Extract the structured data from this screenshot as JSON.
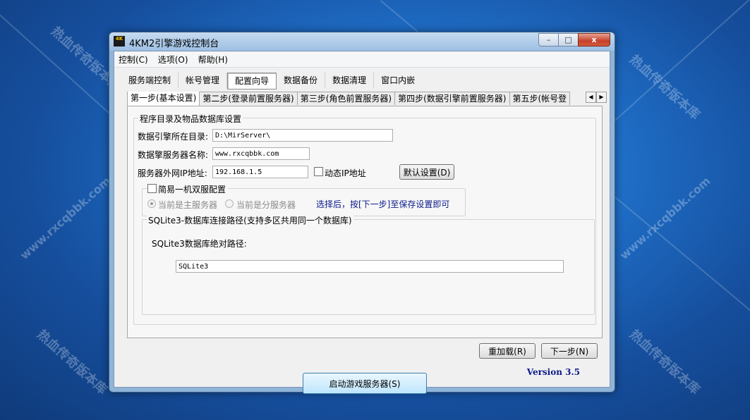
{
  "watermark": {
    "text_cn": "热血传奇版本库",
    "text_url": "www.rxcqbbk.com"
  },
  "window": {
    "title": "4KM2引擎游戏控制台",
    "icon_label": "4K",
    "minimize": "–",
    "maximize": "□",
    "close": "x"
  },
  "menu": [
    "控制(C)",
    "选项(O)",
    "帮助(H)"
  ],
  "top_tabs": [
    {
      "label": "服务端控制"
    },
    {
      "label": "帐号管理"
    },
    {
      "label": "配置向导",
      "active": true
    },
    {
      "label": "数据备份"
    },
    {
      "label": "数据清理"
    },
    {
      "label": "窗口内嵌"
    }
  ],
  "step_tabs": [
    {
      "label": "第一步(基本设置)",
      "active": true
    },
    {
      "label": "第二步(登录前置服务器)"
    },
    {
      "label": "第三步(角色前置服务器)"
    },
    {
      "label": "第四步(数据引擎前置服务器)"
    },
    {
      "label": "第五步(帐号登"
    }
  ],
  "form": {
    "group_title": "程序目录及物品数据库设置",
    "engine_dir_label": "数据引擎所在目录:",
    "engine_dir_value": "D:\\MirServer\\",
    "server_name_label": "数据擎服务器名称:",
    "server_name_value": "www.rxcqbbk.com",
    "ip_label": "服务器外网IP地址:",
    "ip_value": "192.168.1.5",
    "dynamic_ip_label": "动态IP地址",
    "default_btn": "默认设置(D)",
    "dual_group_label": "简易一机双服配置",
    "radio_main": "当前是主服务器",
    "radio_sub": "当前是分服务器",
    "hint": "选择后，按[下一步]至保存设置即可",
    "sqlite_group": "SQLite3-数据库连接路径(支持多区共用同一个数据库)",
    "sqlite_label": "SQLite3数据库绝对路径:",
    "sqlite_value": "SQLite3"
  },
  "buttons": {
    "reload": "重加载(R)",
    "next": "下一步(N)",
    "start": "启动游戏服务器(S)"
  },
  "version": "Version 3.5"
}
